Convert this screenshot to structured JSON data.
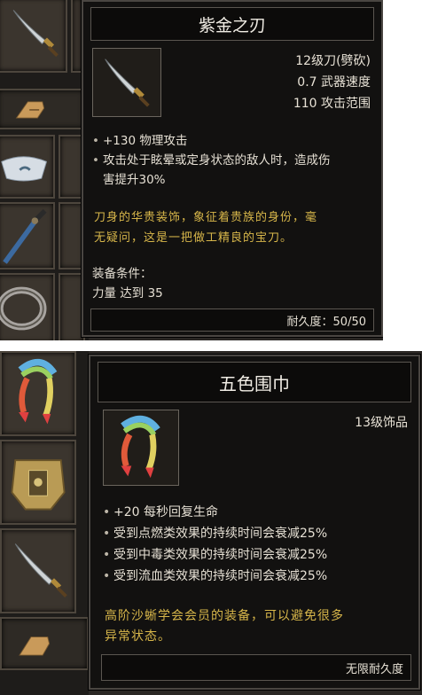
{
  "tooltip1": {
    "title": "紫金之刃",
    "stats": [
      "12级刀(劈砍)",
      "0.7 武器速度",
      "110 攻击范围"
    ],
    "bullets": [
      "+130 物理攻击",
      "攻击处于眩晕或定身状态的敌人时，造成伤",
      "害提升30%"
    ],
    "lore": [
      "刀身的华贵装饰，象征着贵族的身份，毫",
      "无疑问，这是一把做工精良的宝刀。"
    ],
    "requirement_label": "装备条件：",
    "requirement_value": "力量 达到 35",
    "durability": "耐久度：50/50"
  },
  "tooltip2": {
    "title": "五色围巾",
    "stats": [
      "13级饰品"
    ],
    "bullets": [
      "+20 每秒回复生命",
      "受到点燃类效果的持续时间会衰减25%",
      "受到中毒类效果的持续时间会衰减25%",
      "受到流血类效果的持续时间会衰减25%"
    ],
    "lore": [
      "高阶沙蜥学会会员的装备，可以避免很多",
      "异常状态。"
    ],
    "durability": "无限耐久度"
  },
  "inventory_icons": [
    "saber-icon",
    "scroll-icon",
    "cloth-hat-icon",
    "sword-icon",
    "bracelet-icon",
    "scarf-icon",
    "armor-icon",
    "saber-icon",
    "scroll-icon"
  ],
  "colors": {
    "lore": "#d7b64a",
    "panel": "#121110",
    "border": "#4a4642"
  }
}
